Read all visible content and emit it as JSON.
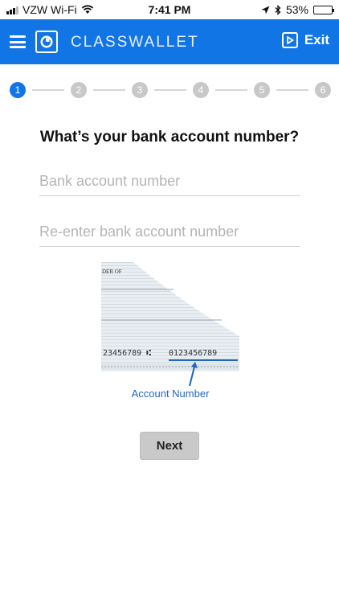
{
  "status_bar": {
    "carrier": "VZW Wi-Fi",
    "time": "7:41 PM",
    "battery_percent": "53%",
    "battery_level": 0.53,
    "icons": [
      "signal-icon",
      "wifi-icon",
      "location-icon",
      "bluetooth-icon",
      "battery-icon"
    ]
  },
  "header": {
    "brand": "CLASSWALLET",
    "exit_label": "Exit",
    "background_color": "#1275e6",
    "icons": [
      "menu-icon",
      "classwallet-logo-icon",
      "exit-icon"
    ]
  },
  "stepper": {
    "steps": [
      "1",
      "2",
      "3",
      "4",
      "5",
      "6"
    ],
    "current_step": 1,
    "active_color": "#1275e6",
    "inactive_color": "#c8c8c8"
  },
  "form": {
    "title": "What’s your bank account number?",
    "account_number_placeholder": "Bank account number",
    "account_number_value": "",
    "reenter_placeholder": "Re-enter bank account number",
    "reenter_value": ""
  },
  "illustration": {
    "check_header_text": "DER OF",
    "routing_digits": "23456789 ⑆",
    "account_digits": "0123456789",
    "caption": "Account Number"
  },
  "actions": {
    "next_label": "Next"
  }
}
